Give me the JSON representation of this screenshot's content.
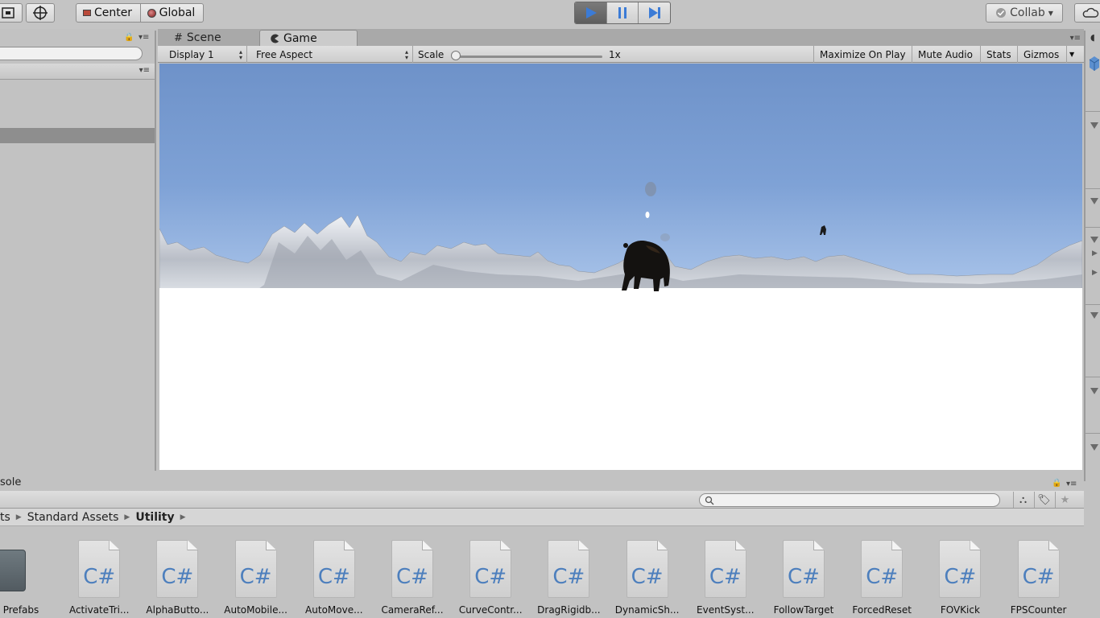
{
  "toolbar": {
    "pivot_label": "Center",
    "space_label": "Global",
    "collab_label": "Collab",
    "icons": {
      "play": "play-icon",
      "pause": "pause-icon",
      "step": "step-icon",
      "cloud": "cloud-icon"
    }
  },
  "tabs": [
    {
      "label": "Scene",
      "icon": "grid-icon"
    },
    {
      "label": "Game",
      "icon": "pacman-icon"
    }
  ],
  "game_toolbar": {
    "display": "Display 1",
    "aspect": "Free Aspect",
    "scale_label": "Scale",
    "scale_value": "1x",
    "scale_fraction": 0.0,
    "maximize": "Maximize On Play",
    "mute": "Mute Audio",
    "stats": "Stats",
    "gizmos": "Gizmos"
  },
  "colors": {
    "sky_top": "#6e92c9",
    "sky_horizon": "#c8daf3",
    "snow": "#ffffff",
    "play_active": "#3b7bd6",
    "csharp": "#4d7fbd",
    "folder": "#5f6a70"
  },
  "console": {
    "label": "sole"
  },
  "breadcrumb": {
    "items": [
      "ts",
      "Standard Assets"
    ],
    "current": "Utility"
  },
  "assets": [
    {
      "name": "Prefabs",
      "type": "folder"
    },
    {
      "name": "ActivateTri...",
      "type": "C#"
    },
    {
      "name": "AlphaButto...",
      "type": "C#"
    },
    {
      "name": "AutoMobile...",
      "type": "C#"
    },
    {
      "name": "AutoMove...",
      "type": "C#"
    },
    {
      "name": "CameraRef...",
      "type": "C#"
    },
    {
      "name": "CurveContr...",
      "type": "C#"
    },
    {
      "name": "DragRigidb...",
      "type": "C#"
    },
    {
      "name": "DynamicSh...",
      "type": "C#"
    },
    {
      "name": "EventSyst...",
      "type": "C#"
    },
    {
      "name": "FollowTarget",
      "type": "C#"
    },
    {
      "name": "ForcedReset",
      "type": "C#"
    },
    {
      "name": "FOVKick",
      "type": "C#"
    },
    {
      "name": "FPSCounter",
      "type": "C#"
    }
  ]
}
